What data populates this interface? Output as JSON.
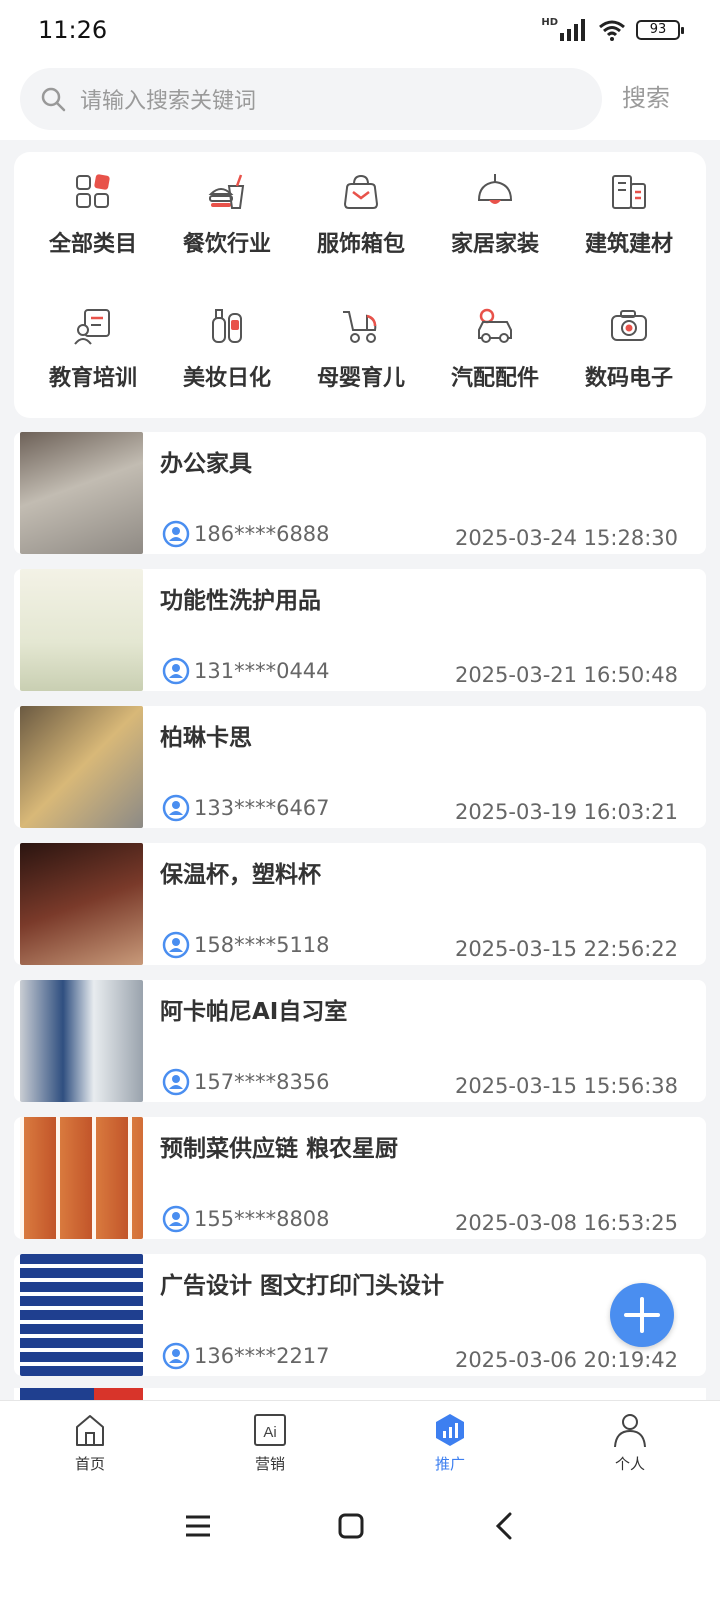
{
  "status_bar": {
    "time": "11:26",
    "network": "HD",
    "battery": "93"
  },
  "search": {
    "placeholder": "请输入搜索关键词",
    "button_label": "搜索"
  },
  "categories": [
    {
      "label": "全部类目",
      "icon": "grid-icon"
    },
    {
      "label": "餐饮行业",
      "icon": "food-drink-icon"
    },
    {
      "label": "服饰箱包",
      "icon": "bag-icon"
    },
    {
      "label": "家居家装",
      "icon": "lamp-icon"
    },
    {
      "label": "建筑建材",
      "icon": "building-icon"
    },
    {
      "label": "教育培训",
      "icon": "education-icon"
    },
    {
      "label": "美妆日化",
      "icon": "cosmetics-icon"
    },
    {
      "label": "母婴育儿",
      "icon": "stroller-icon"
    },
    {
      "label": "汽配配件",
      "icon": "car-icon"
    },
    {
      "label": "数码电子",
      "icon": "camera-icon"
    }
  ],
  "listings": [
    {
      "title": "办公家具",
      "phone": "186****6888",
      "date": "2025-03-24 15:28:30",
      "thumb_color": "#a8a29a"
    },
    {
      "title": "功能性洗护用品",
      "phone": "131****0444",
      "date": "2025-03-21 16:50:48",
      "thumb_color": "#e9eadc"
    },
    {
      "title": "柏琳卡思",
      "phone": "133****6467",
      "date": "2025-03-19 16:03:21",
      "thumb_color": "#b8924f"
    },
    {
      "title": "保温杯，塑料杯",
      "phone": "158****5118",
      "date": "2025-03-15 22:56:22",
      "thumb_color": "#5a2a22"
    },
    {
      "title": "阿卡帕尼AI自习室",
      "phone": "157****8356",
      "date": "2025-03-15 15:56:38",
      "thumb_color": "#3e5c84"
    },
    {
      "title": "预制菜供应链 粮农星厨",
      "phone": "155****8808",
      "date": "2025-03-08 16:53:25",
      "thumb_color": "#d9824a"
    },
    {
      "title": "广告设计 图文打印门头设计",
      "phone": "136****2217",
      "date": "2025-03-06 20:19:42",
      "thumb_color": "#1f3f8f"
    }
  ],
  "bottom_nav": [
    {
      "label": "首页",
      "icon": "home-icon"
    },
    {
      "label": "营销",
      "icon": "ai-icon"
    },
    {
      "label": "推广",
      "icon": "promote-chart-icon",
      "active": true
    },
    {
      "label": "个人",
      "icon": "person-icon"
    }
  ],
  "colors": {
    "accent": "#3d7ff0",
    "fab": "#4a8ef0",
    "category_icon_red": "#e8524a"
  }
}
